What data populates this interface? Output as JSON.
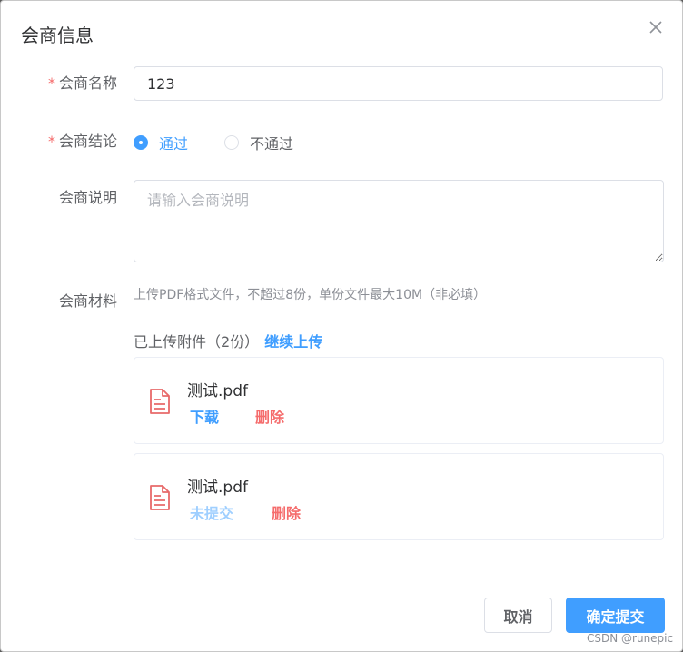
{
  "dialog": {
    "title": "会商信息"
  },
  "form": {
    "name": {
      "label": "会商名称",
      "value": "123",
      "required_mark": "*"
    },
    "conclusion": {
      "label": "会商结论",
      "required_mark": "*",
      "options": [
        {
          "label": "通过",
          "checked": true
        },
        {
          "label": "不通过",
          "checked": false
        }
      ]
    },
    "description": {
      "label": "会商说明",
      "placeholder": "请输入会商说明",
      "value": ""
    },
    "materials": {
      "label": "会商材料",
      "tip": "上传PDF格式文件，不超过8份，单份文件最大10M（非必填）",
      "uploaded_text": "已上传附件（2份）",
      "continue_upload": "继续上传",
      "files": [
        {
          "name": "测试.pdf",
          "primary_action": "下载",
          "delete_action": "删除"
        },
        {
          "name": "测试.pdf",
          "primary_action": "未提交",
          "delete_action": "删除"
        }
      ]
    }
  },
  "footer": {
    "cancel": "取消",
    "confirm": "确定提交"
  },
  "watermark": "CSDN @runepic",
  "colors": {
    "primary": "#409eff",
    "danger": "#f56c6c",
    "disabled_link": "#9fcfff",
    "file_icon": "#e86a6a"
  },
  "icons": {
    "close": "close-icon",
    "file": "pdf-file-icon"
  }
}
